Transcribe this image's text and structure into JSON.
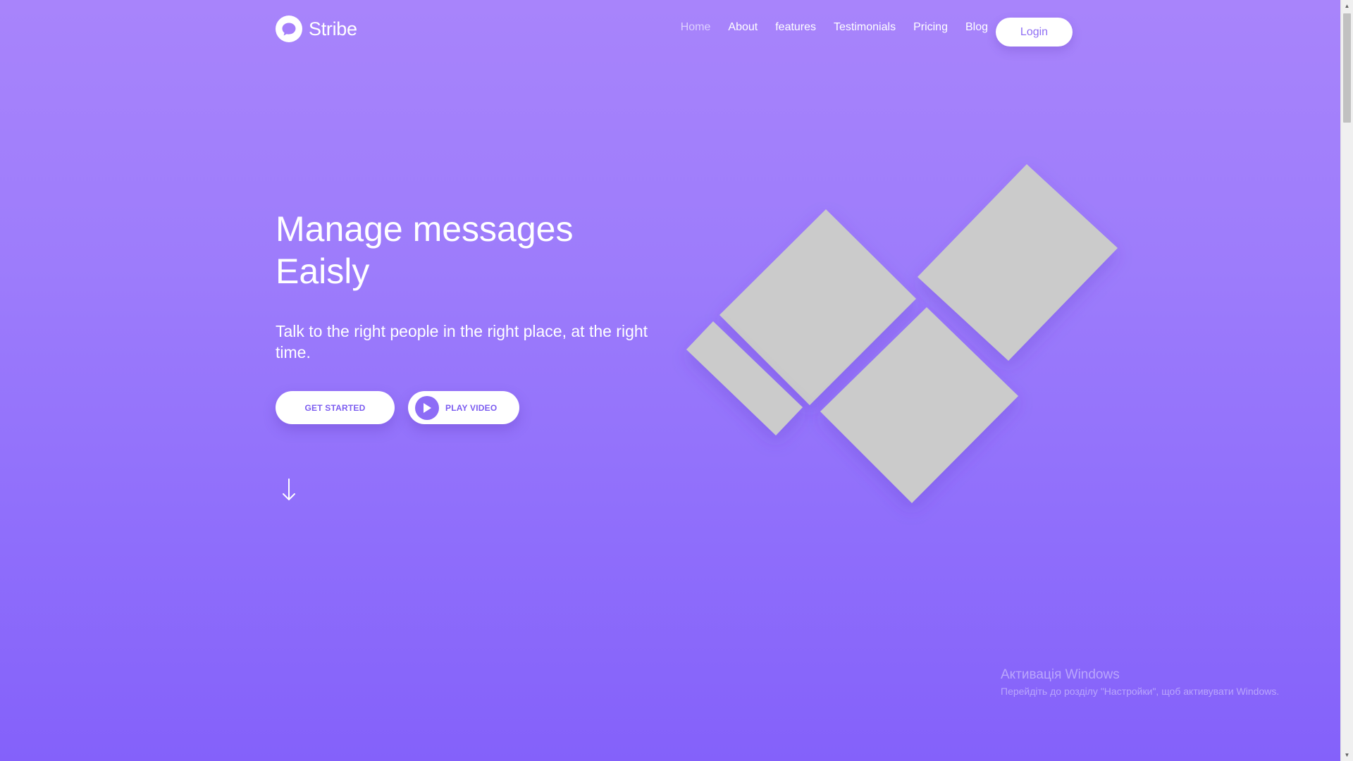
{
  "header": {
    "brand": {
      "name": "Stribe",
      "icon": "chat-bubble-icon"
    },
    "nav": [
      {
        "label": "Home",
        "active": true
      },
      {
        "label": "About"
      },
      {
        "label": "features"
      },
      {
        "label": "Testimonials"
      },
      {
        "label": "Pricing"
      },
      {
        "label": "Blog"
      }
    ],
    "login_label": "Login"
  },
  "hero": {
    "title_line1": "Manage messages",
    "title_line2": "Eaisly",
    "subtitle": "Talk to the right people in the right place, at the right time.",
    "get_started_label": "GET STARTED",
    "play_video_label": "PLAY VIDEO",
    "play_icon": "play-icon",
    "scroll_icon": "arrow-down-icon"
  },
  "illustration": {
    "shape_color": "#cbcbcb",
    "shape_count": 4
  },
  "watermark": {
    "title": "Активація Windows",
    "subtitle": "Перейдіть до розділу \"Настройки\", щоб активувати Windows."
  },
  "colors": {
    "background_top": "#a884fb",
    "background_bottom": "#8461fa",
    "accent": "#8d6cf6",
    "text": "#ffffff"
  }
}
